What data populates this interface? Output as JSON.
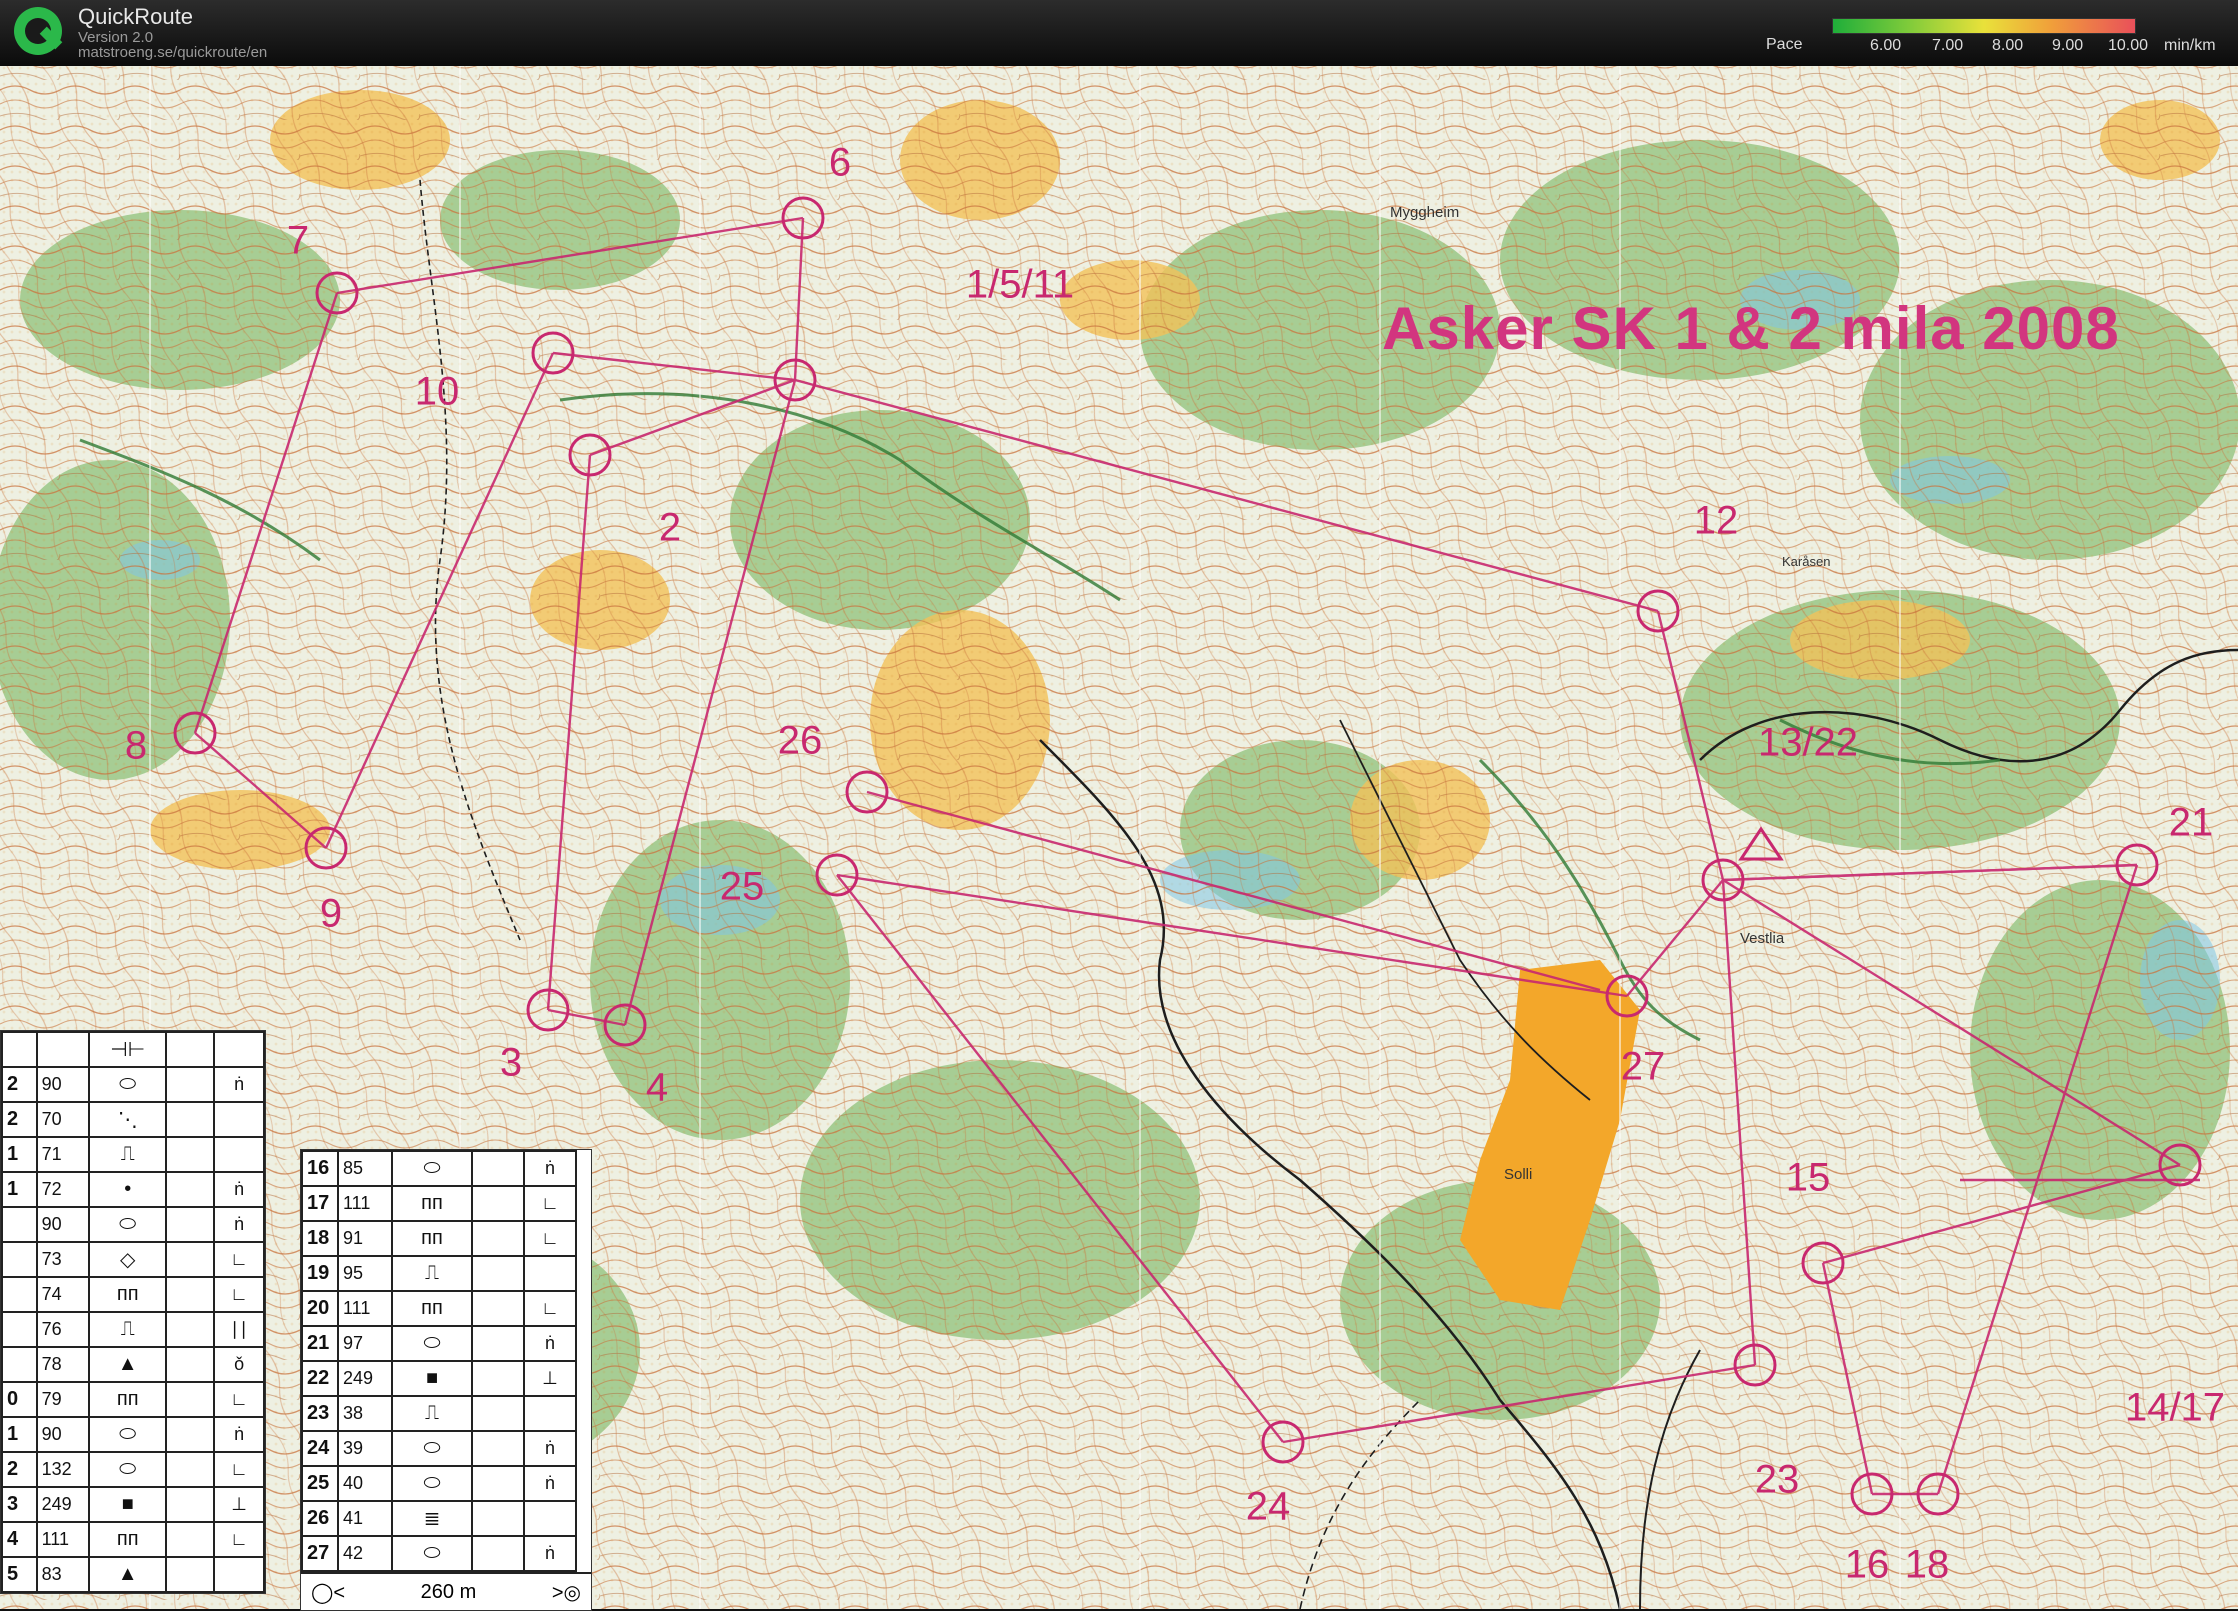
{
  "app": {
    "name": "QuickRoute",
    "version": "Version 2.0",
    "url": "matstroeng.se/quickroute/en"
  },
  "pace_legend": {
    "label": "Pace",
    "ticks": [
      "6.00",
      "7.00",
      "8.00",
      "9.00",
      "10.00"
    ],
    "unit": "min/km",
    "colors": [
      "#1fae3a",
      "#7fcb3a",
      "#e9e13a",
      "#f0a03a",
      "#e9505a"
    ]
  },
  "map": {
    "title": "Asker SK 1 & 2 mila 2008",
    "place_names": [
      "Myggheim",
      "Karåsen",
      "Vestlia",
      "Solli"
    ],
    "course_color": "#c8286f",
    "controls": [
      {
        "label": "1/5/11"
      },
      {
        "label": "2"
      },
      {
        "label": "3"
      },
      {
        "label": "4"
      },
      {
        "label": "6"
      },
      {
        "label": "7"
      },
      {
        "label": "8"
      },
      {
        "label": "9"
      },
      {
        "label": "10"
      },
      {
        "label": "12"
      },
      {
        "label": "13/22"
      },
      {
        "label": "14/17"
      },
      {
        "label": "15"
      },
      {
        "label": "16"
      },
      {
        "label": "18"
      },
      {
        "label": "21"
      },
      {
        "label": "23"
      },
      {
        "label": "24"
      },
      {
        "label": "25"
      },
      {
        "label": "26"
      },
      {
        "label": "27"
      }
    ]
  },
  "control_cards": {
    "left": {
      "rows": [
        {
          "code": "",
          "cc": "",
          "sym": "⊣⊢",
          "col": ""
        },
        {
          "code": "2",
          "cc": "90",
          "sym": "⬭",
          "col": "ṅ"
        },
        {
          "code": "2",
          "cc": "70",
          "sym": "⋱",
          "col": ""
        },
        {
          "code": "1",
          "cc": "71",
          "sym": "⎍",
          "col": ""
        },
        {
          "code": "1",
          "cc": "72",
          "sym": "•",
          "col": "ṅ"
        },
        {
          "code": "",
          "cc": "90",
          "sym": "⬭",
          "col": "ṅ"
        },
        {
          "code": "",
          "cc": "73",
          "sym": "◇",
          "col": "∟"
        },
        {
          "code": "",
          "cc": "74",
          "sym": "ᴨᴨ",
          "col": "∟"
        },
        {
          "code": "",
          "cc": "76",
          "sym": "⎍",
          "col": "∣∣"
        },
        {
          "code": "",
          "cc": "78",
          "sym": "▲",
          "col": "ǒ"
        },
        {
          "code": "0",
          "cc": "79",
          "sym": "ᴨᴨ",
          "col": "∟"
        },
        {
          "code": "1",
          "cc": "90",
          "sym": "⬭",
          "col": "ṅ"
        },
        {
          "code": "2",
          "cc": "132",
          "sym": "⬭",
          "col": "∟"
        },
        {
          "code": "3",
          "cc": "249",
          "sym": "■",
          "col": "⊥"
        },
        {
          "code": "4",
          "cc": "111",
          "sym": "ᴨᴨ",
          "col": "∟"
        },
        {
          "code": "5",
          "cc": "83",
          "sym": "▲",
          "col": ""
        }
      ]
    },
    "right": {
      "rows": [
        {
          "code": "16",
          "cc": "85",
          "sym": "⬭",
          "col": "ṅ"
        },
        {
          "code": "17",
          "cc": "111",
          "sym": "ᴨᴨ",
          "col": "∟"
        },
        {
          "code": "18",
          "cc": "91",
          "sym": "ᴨᴨ",
          "col": "∟"
        },
        {
          "code": "19",
          "cc": "95",
          "sym": "⎍",
          "col": ""
        },
        {
          "code": "20",
          "cc": "111",
          "sym": "ᴨᴨ",
          "col": "∟"
        },
        {
          "code": "21",
          "cc": "97",
          "sym": "⬭",
          "col": "ṅ"
        },
        {
          "code": "22",
          "cc": "249",
          "sym": "■",
          "col": "⊥"
        },
        {
          "code": "23",
          "cc": "38",
          "sym": "⎍",
          "col": ""
        },
        {
          "code": "24",
          "cc": "39",
          "sym": "⬭",
          "col": "ṅ"
        },
        {
          "code": "25",
          "cc": "40",
          "sym": "⬭",
          "col": "ṅ"
        },
        {
          "code": "26",
          "cc": "41",
          "sym": "≣",
          "col": ""
        },
        {
          "code": "27",
          "cc": "42",
          "sym": "⬭",
          "col": "ṅ"
        }
      ],
      "footer_distance": "260 m"
    }
  }
}
